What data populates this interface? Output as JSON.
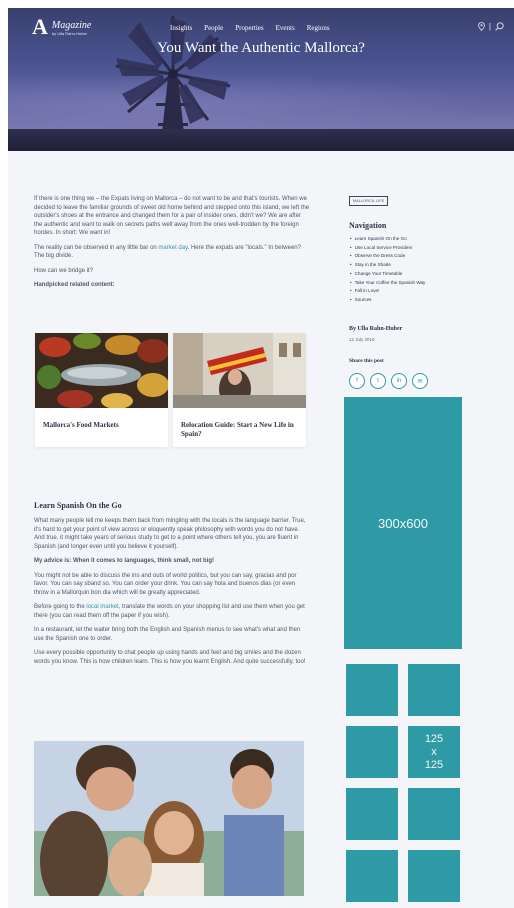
{
  "header": {
    "logo_letter": "A",
    "logo_name": "Magazine",
    "logo_sub": "by Ulla Rahn-Huber",
    "nav": [
      "Insights",
      "People",
      "Properties",
      "Events",
      "Regions"
    ],
    "search_icon": "search-icon",
    "location_icon": "location-pin-icon",
    "title": "You Want the Authentic Mallorca?"
  },
  "intro": {
    "p1": "If there is one thing we – the Expats living on Mallorca – do not want to be and that's tourists. When we decided to leave the familiar grounds of sweet old home behind and stepped onto this island, we left the outsider's shoes at the entrance and changed them for a pair of insider ones, didn't we? We are after the authentic and want to walk on secrets paths well away from the ones well-trodden by the foreign hordes. In short: We want in!",
    "p2_before": "The reality can be observed in any little bar on ",
    "p2_link": "market day",
    "p2_after": ". Here the expats are \"locals.\" In between? The big divide.",
    "p3": "How can we bridge it?",
    "related_label": "Handpicked related content:"
  },
  "cards": [
    {
      "title": "Mallorca's Food Markets"
    },
    {
      "title": "Relocation Guide: Start a New Life in Spain?"
    }
  ],
  "lang": {
    "heading": "Learn Spanish On the Go",
    "p1": "What many people tell me keeps them back from mingling with the locals is the language barrier. True, it's hard to get your point of view across or eloquently speak philosophy with words you do not have. And true, it might take years of serious study to get to a point where others tell you, you are fluent in Spanish (and longer even until you believe it yourself).",
    "advice": "My advice is: When it comes to languages, think small, not big!",
    "p2": "You might not be able to discuss the ins and outs of world politics, but you can say, gracias and por favor. You can say sband so. You can order your drink. You can say hola and buenos dias (or even throw in a Mallorquin bon dia which will be greatly appreciated.",
    "p3_before": "Before going to the ",
    "p3_link": "local market",
    "p3_after": ", translate the words on your shopping list and use them when you get there (you can read them off the paper if you wish).",
    "p4": "In a restaurant, let the waiter bring both the English and Spanish menus to see what's what and then use the Spanish one to order.",
    "p5": "Use every possible opportunity to chat people up using hands and feet and big smiles and the dozen words you know. This is how children learn. This is how you learnt English. And quite successfully, too!"
  },
  "sidebar": {
    "tag": "Mallorca life",
    "nav_heading": "Navigation",
    "nav_items": [
      "Learn Spanish On the Go",
      "Use Local Service Providers",
      "Observe the Dress Code",
      "Stay in the Shade",
      "Change Your Timetable",
      "Take Your Coffee the Spanish Way",
      "Fall in Love!",
      "Sources"
    ],
    "author": "By Ulla Rahn-Huber",
    "date": "12 July 2019",
    "share_heading": "Share this post",
    "share_icons": [
      "facebook-icon",
      "twitter-icon",
      "linkedin-icon",
      "email-icon"
    ]
  },
  "ads": {
    "big": "300x600",
    "small_top": "125",
    "small_x": "x",
    "small_bottom": "125"
  },
  "colors": {
    "accent": "#2e9aa5",
    "hero": "#4b5491"
  }
}
